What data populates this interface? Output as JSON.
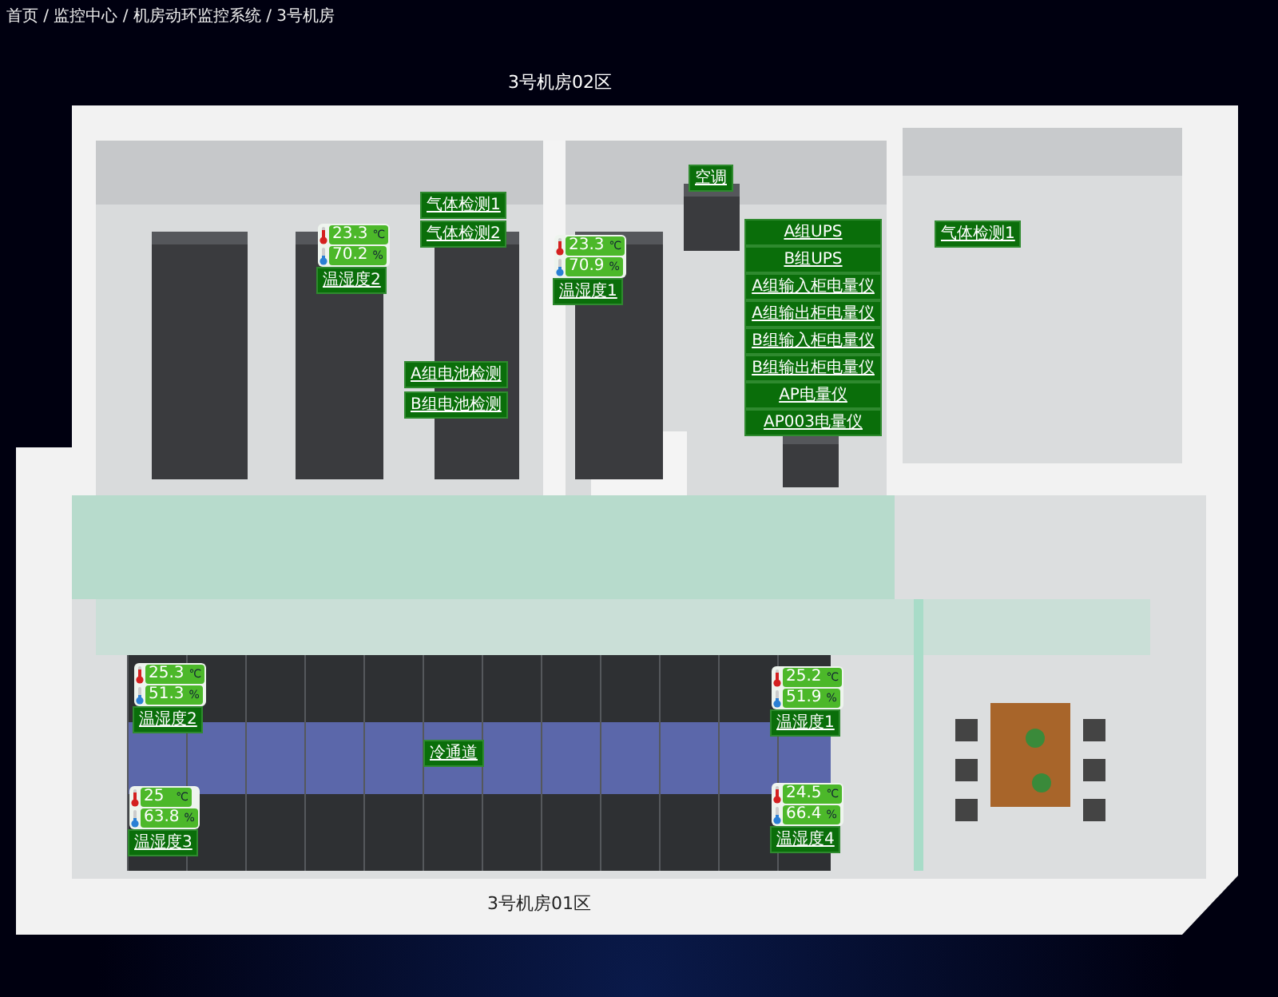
{
  "breadcrumb": "首页 / 监控中心 / 机房动环监控系统 / 3号机房",
  "zones": [
    {
      "label": "3号机房02区"
    },
    {
      "label": "3号机房01区"
    }
  ],
  "devices": [
    {
      "label": "气体检测1"
    },
    {
      "label": "气体检测2"
    },
    {
      "label": "A组电池检测"
    },
    {
      "label": "B组电池检测"
    },
    {
      "label": "空调"
    },
    {
      "label": "A组UPS"
    },
    {
      "label": "B组UPS"
    },
    {
      "label": "A组输入柜电量仪"
    },
    {
      "label": "A组输出柜电量仪"
    },
    {
      "label": "B组输入柜电量仪"
    },
    {
      "label": "B组输出柜电量仪"
    },
    {
      "label": "AP电量仪"
    },
    {
      "label": "AP003电量仪"
    },
    {
      "label": "气体检测1"
    }
  ],
  "aisle": {
    "label": "冷通道"
  },
  "sensors": [
    {
      "name": "温湿度2",
      "temperature": "23.3",
      "temp_unit": "℃",
      "humidity": "70.2",
      "humidity_unit": "%"
    },
    {
      "name": "温湿度1",
      "temperature": "23.3",
      "temp_unit": "℃",
      "humidity": "70.9",
      "humidity_unit": "%"
    },
    {
      "name": "温湿度2",
      "temperature": "25.3",
      "temp_unit": "℃",
      "humidity": "51.3",
      "humidity_unit": "%"
    },
    {
      "name": "温湿度3",
      "temperature": "25",
      "temp_unit": "℃",
      "humidity": "63.8",
      "humidity_unit": "%"
    },
    {
      "name": "温湿度1",
      "temperature": "25.2",
      "temp_unit": "℃",
      "humidity": "51.9",
      "humidity_unit": "%"
    },
    {
      "name": "温湿度4",
      "temperature": "24.5",
      "temp_unit": "℃",
      "humidity": "66.4",
      "humidity_unit": "%"
    }
  ]
}
